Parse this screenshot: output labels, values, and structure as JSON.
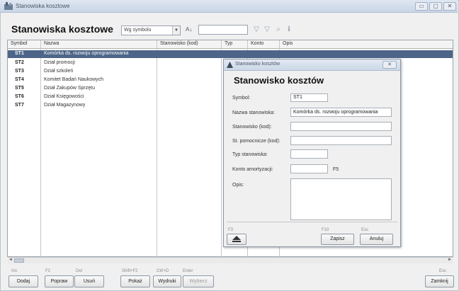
{
  "window": {
    "title": "Stanowiska kosztowe",
    "min_glyph": "▭",
    "max_glyph": "▢",
    "close_glyph": "✕"
  },
  "toolbar": {
    "heading": "Stanowiska kosztowe",
    "sort_value": "Wg symbolu",
    "sort_arrow": "▼",
    "sort_dir": "A↓",
    "search_value": "",
    "icons": [
      "filter-icon",
      "filter-clear-icon",
      "zoom-icon",
      "info-icon"
    ]
  },
  "grid": {
    "columns": [
      "Symbol",
      "Nazwa",
      "Stanowisko (kod)",
      "Typ",
      "Konto",
      "Opis"
    ],
    "rows": [
      {
        "symbol": "ST1",
        "name": "Komórka ds. rozwoju oprogramowania",
        "selected": true
      },
      {
        "symbol": "ST2",
        "name": "Dział promocji",
        "selected": false
      },
      {
        "symbol": "ST3",
        "name": "Dział szkoleń",
        "selected": false
      },
      {
        "symbol": "ST4",
        "name": "Komitet Badań Naukowych",
        "selected": false
      },
      {
        "symbol": "ST5",
        "name": "Dział Zakupów Sprzętu",
        "selected": false
      },
      {
        "symbol": "ST6",
        "name": "Dział Księgowości",
        "selected": false
      },
      {
        "symbol": "ST7",
        "name": "Dział Magazynowy",
        "selected": false
      }
    ]
  },
  "bottom": {
    "hints": [
      "Ins",
      "F2",
      "Del",
      "Shift+F2",
      "Ctrl+D",
      "Enter",
      "Esc"
    ],
    "buttons": {
      "add": "Dodaj",
      "edit": "Popraw",
      "delete": "Usuń",
      "show": "Pokaż",
      "print": "Wydruki",
      "select": "Wybierz",
      "close": "Zamknij"
    }
  },
  "dialog": {
    "title": "Stanowisko kosztów",
    "close_glyph": "✕",
    "heading": "Stanowisko kosztów",
    "fields": {
      "symbol_label": "Symbol:",
      "symbol_value": "ST1",
      "name_label": "Nazwa stanowiska:",
      "name_value": "Komórka ds. rozwoju oprogramowania",
      "code_label": "Stanowisko (kod):",
      "code_value": "",
      "aux_label": "St. pomocnicze (kod):",
      "aux_value": "",
      "type_label": "Typ stanowiska:",
      "type_value": "",
      "account_label": "Konto amortyzacji:",
      "account_value": "",
      "account_suffix": "F5",
      "desc_label": "Opis:",
      "desc_value": ""
    },
    "hints": {
      "f3": "F3",
      "f10": "F10",
      "esc": "Esc"
    },
    "buttons": {
      "save": "Zapisz",
      "cancel": "Anuluj"
    }
  }
}
